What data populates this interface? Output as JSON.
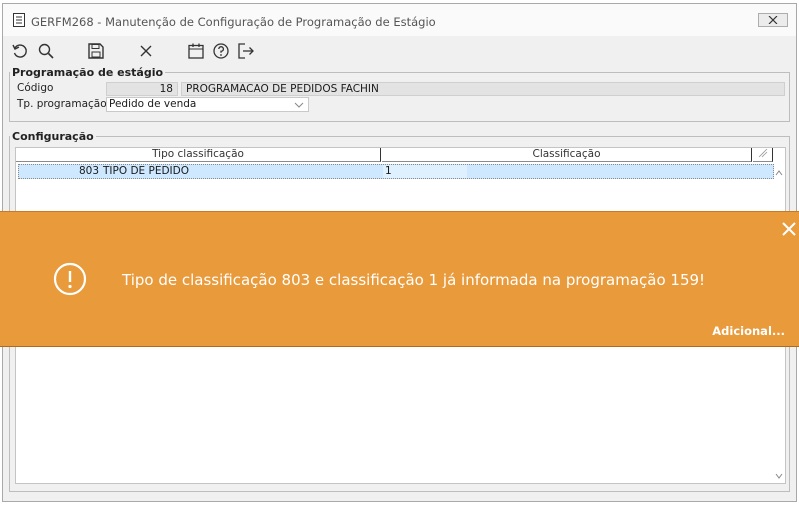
{
  "window": {
    "title": "GERFM268 - Manutenção de Configuração de Programação de Estágio"
  },
  "toolbar": {
    "icons": [
      "undo-icon",
      "search-icon",
      "save-icon",
      "close-icon",
      "calendar-icon",
      "help-icon",
      "exit-icon"
    ]
  },
  "programacao": {
    "legend": "Programação de estágio",
    "codigo_label": "Código",
    "codigo_value": "18",
    "descricao_value": "PROGRAMACAO DE PEDIDOS FACHIN",
    "tipo_label": "Tp. programação",
    "tipo_value": "Pedido de venda"
  },
  "configuracao": {
    "legend": "Configuração",
    "columns": [
      "Tipo classificação",
      "Classificação"
    ],
    "rows": [
      {
        "codigo": "803",
        "tipo": "TIPO DE PEDIDO",
        "classificacao": "1"
      }
    ]
  },
  "toast": {
    "message": "Tipo de classificação 803 e classificação 1 já informada na programação 159!",
    "more_label": "Adicional...",
    "color": "#e99a3b"
  }
}
